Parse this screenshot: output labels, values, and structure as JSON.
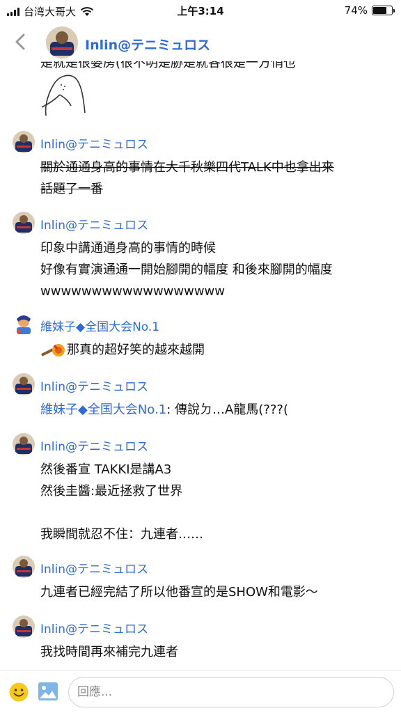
{
  "status_bar": {
    "carrier": "台湾大哥大",
    "time": "上午3:14",
    "battery": "74%",
    "battery_level": 0.74
  },
  "header": {
    "title": "Inlin@テニミュロス"
  },
  "partial_top_text": "是就是很婆房(很不明是胁是就各很是一方悄也",
  "messages": [
    {
      "name": "Inlin@テニミュロス",
      "lines": [
        "關於通通身高的事情在大千秋樂四代TALK中也拿出來",
        "話題了一番"
      ],
      "strike": true
    },
    {
      "name": "Inlin@テニミュロス",
      "lines": [
        "印象中講通通身高的事情的時候",
        "好像有實演通通一開始腳開的幅度 和後來腳開的幅度",
        "wwwwwwwwwwwwwwwwww"
      ]
    },
    {
      "name": "維妹子◆全国大会No.1",
      "lines": [
        "那真的超好笑的越來越開"
      ]
    },
    {
      "name": "Inlin@テニミュロス",
      "mention": "維妹子◆全国大会No.1",
      "lines": [
        ": 傳說ㄉ…A龍馬(???("
      ]
    },
    {
      "name": "Inlin@テニミュロス",
      "lines": [
        "然後番宣 TAKKI是講A3",
        "然後圭醬:最近拯救了世界",
        "",
        "我瞬間就忍不住：九連者……"
      ]
    },
    {
      "name": "Inlin@テニミュロス",
      "lines": [
        "九連者已經完結了所以他番宣的是SHOW和電影～"
      ]
    },
    {
      "name": "Inlin@テニミュロス",
      "lines": [
        "我找時間再來補完九連者"
      ]
    }
  ],
  "reply": {
    "placeholder": "回應..."
  }
}
